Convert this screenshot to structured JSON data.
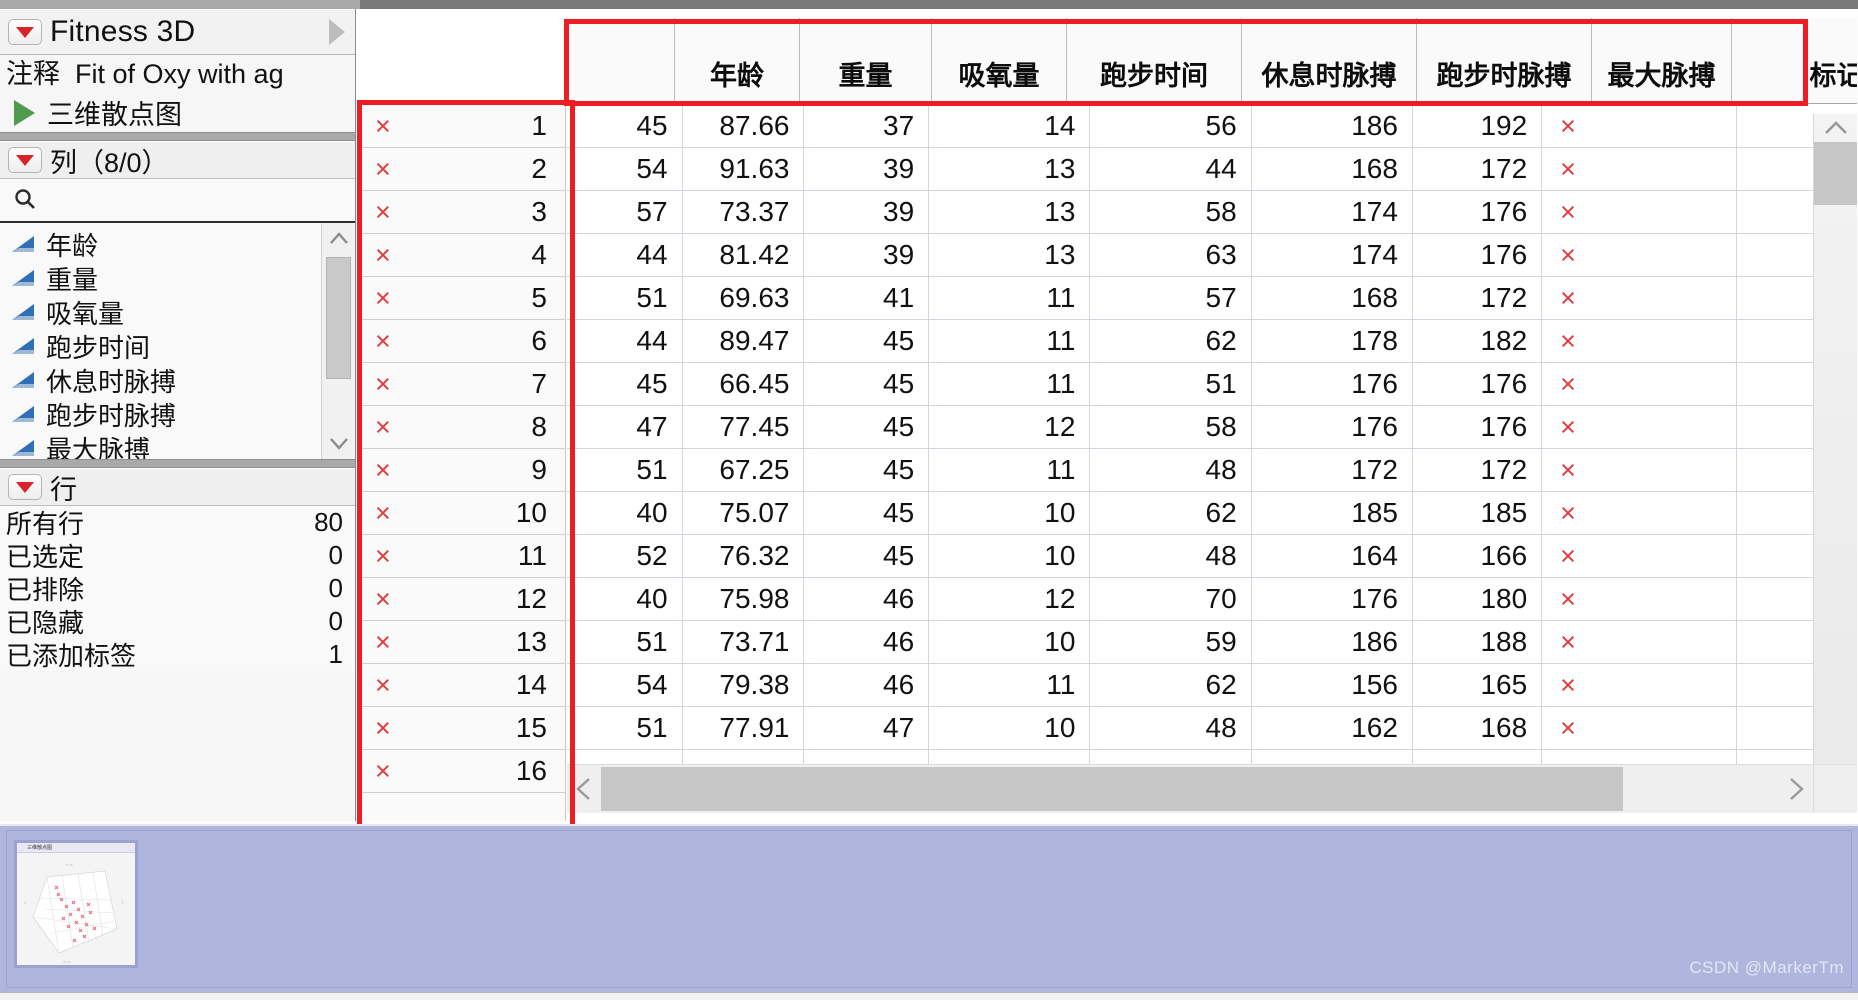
{
  "window": {
    "title": "Fitness 3D",
    "expand_icon": "triangle-right-icon",
    "menu_icon": "red-triangle-menu-icon"
  },
  "annotation": {
    "label": "注释",
    "value": "Fit of Oxy with ag",
    "script_icon": "green-play-triangle-icon",
    "script_label": "三维散点图"
  },
  "columns_panel": {
    "header": "列（8/0）",
    "search_placeholder": "",
    "search_icon": "search-icon",
    "items": [
      {
        "label": "年龄",
        "icon": "continuous-column-icon"
      },
      {
        "label": "重量",
        "icon": "continuous-column-icon"
      },
      {
        "label": "吸氧量",
        "icon": "continuous-column-icon"
      },
      {
        "label": "跑步时间",
        "icon": "continuous-column-icon"
      },
      {
        "label": "休息时脉搏",
        "icon": "continuous-column-icon"
      },
      {
        "label": "跑步时脉搏",
        "icon": "continuous-column-icon"
      },
      {
        "label": "最大脉搏",
        "icon": "continuous-column-icon"
      }
    ]
  },
  "rows_panel": {
    "header": "行",
    "stats": [
      {
        "label": "所有行",
        "value": "80"
      },
      {
        "label": "已选定",
        "value": "0"
      },
      {
        "label": "已排除",
        "value": "0"
      },
      {
        "label": "已隐藏",
        "value": "0"
      },
      {
        "label": "已添加标签",
        "value": "1"
      }
    ]
  },
  "table": {
    "headers": [
      "年龄",
      "重量",
      "吸氧量",
      "跑步时间",
      "休息时脉搏",
      "跑步时脉搏",
      "最大脉搏",
      "标记"
    ],
    "row_marker": "×",
    "rows": [
      {
        "n": "1",
        "cells": [
          "45",
          "87.66",
          "37",
          "14",
          "56",
          "186",
          "192",
          "×"
        ]
      },
      {
        "n": "2",
        "cells": [
          "54",
          "91.63",
          "39",
          "13",
          "44",
          "168",
          "172",
          "×"
        ]
      },
      {
        "n": "3",
        "cells": [
          "57",
          "73.37",
          "39",
          "13",
          "58",
          "174",
          "176",
          "×"
        ]
      },
      {
        "n": "4",
        "cells": [
          "44",
          "81.42",
          "39",
          "13",
          "63",
          "174",
          "176",
          "×"
        ]
      },
      {
        "n": "5",
        "cells": [
          "51",
          "69.63",
          "41",
          "11",
          "57",
          "168",
          "172",
          "×"
        ]
      },
      {
        "n": "6",
        "cells": [
          "44",
          "89.47",
          "45",
          "11",
          "62",
          "178",
          "182",
          "×"
        ]
      },
      {
        "n": "7",
        "cells": [
          "45",
          "66.45",
          "45",
          "11",
          "51",
          "176",
          "176",
          "×"
        ]
      },
      {
        "n": "8",
        "cells": [
          "47",
          "77.45",
          "45",
          "12",
          "58",
          "176",
          "176",
          "×"
        ]
      },
      {
        "n": "9",
        "cells": [
          "51",
          "67.25",
          "45",
          "11",
          "48",
          "172",
          "172",
          "×"
        ]
      },
      {
        "n": "10",
        "cells": [
          "40",
          "75.07",
          "45",
          "10",
          "62",
          "185",
          "185",
          "×"
        ]
      },
      {
        "n": "11",
        "cells": [
          "52",
          "76.32",
          "45",
          "10",
          "48",
          "164",
          "166",
          "×"
        ]
      },
      {
        "n": "12",
        "cells": [
          "40",
          "75.98",
          "46",
          "12",
          "70",
          "176",
          "180",
          "×"
        ]
      },
      {
        "n": "13",
        "cells": [
          "51",
          "73.71",
          "46",
          "10",
          "59",
          "186",
          "188",
          "×"
        ]
      },
      {
        "n": "14",
        "cells": [
          "54",
          "79.38",
          "46",
          "11",
          "62",
          "156",
          "165",
          "×"
        ]
      },
      {
        "n": "15",
        "cells": [
          "51",
          "77.91",
          "47",
          "10",
          "48",
          "162",
          "168",
          "×"
        ]
      },
      {
        "n": "16",
        "cells": [
          "",
          "",
          "",
          "",
          "",
          "",
          "",
          ""
        ]
      }
    ]
  },
  "scrollbars": {
    "v_up_icon": "chevron-up-icon",
    "v_down_icon": "chevron-down-icon",
    "h_left_icon": "chevron-left-icon",
    "h_right_icon": "chevron-right-icon"
  },
  "taskbar": {
    "thumbnail_title": "三维散点图",
    "watermark": "CSDN @MarkerTm"
  }
}
